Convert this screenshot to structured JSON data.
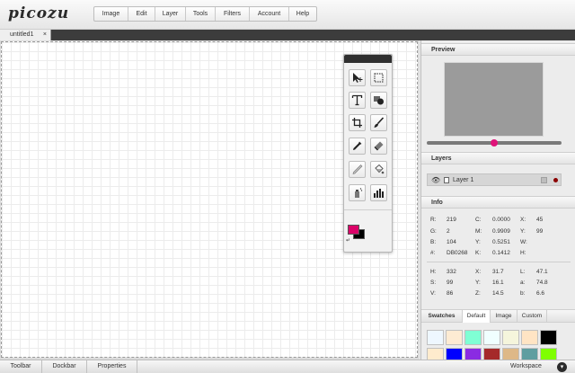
{
  "app": {
    "logo": "picozu"
  },
  "menu": {
    "items": [
      "Image",
      "Edit",
      "Layer",
      "Tools",
      "Filters",
      "Account",
      "Help"
    ]
  },
  "document": {
    "tab_title": "untitled1",
    "close_glyph": "×"
  },
  "toolbox": {
    "tools": [
      "move-tool",
      "marquee-select-tool",
      "text-tool",
      "shape-tool",
      "crop-tool",
      "brush-tool",
      "eyedropper-tool",
      "eraser-tool",
      "smudge-tool",
      "fill-tool",
      "spray-tool",
      "histogram-tool"
    ],
    "foreground_color": "#DB0268",
    "background_color": "#000000"
  },
  "panels": {
    "preview": {
      "title": "Preview",
      "zoom_level": 0.5
    },
    "layers": {
      "title": "Layers",
      "items": [
        {
          "name": "Layer 1"
        }
      ]
    },
    "info": {
      "title": "Info",
      "rgb": {
        "r_label": "R:",
        "r": "219",
        "g_label": "G:",
        "g": "2",
        "b_label": "B:",
        "b": "104",
        "hex_label": "#:",
        "hex": "DB0268"
      },
      "cmyk": {
        "c_label": "C:",
        "c": "0.0000",
        "m_label": "M:",
        "m": "0.9909",
        "y_label": "Y:",
        "y": "0.5251",
        "k_label": "K:",
        "k": "0.1412"
      },
      "pos": {
        "x_label": "X:",
        "x": "45",
        "y_label": "Y:",
        "y": "99",
        "w_label": "W:",
        "h_label": "H:"
      },
      "hsv": {
        "h_label": "H:",
        "h": "332",
        "s_label": "S:",
        "s": "99",
        "v_label": "V:",
        "v": "86"
      },
      "xyz": {
        "x_label": "X:",
        "x": "31.7",
        "y_label": "Y:",
        "y": "16.1",
        "z_label": "Z:",
        "z": "14.5"
      },
      "lab": {
        "l_label": "L:",
        "l": "47.1",
        "a_label": "a:",
        "a": "74.8",
        "b_label": "b:",
        "b": "6.6"
      }
    },
    "swatches": {
      "tabs": [
        "Swatches",
        "Default",
        "Image",
        "Custom"
      ],
      "active_tab": "Default",
      "colors": [
        "#EEF7FF",
        "#FDEBD3",
        "#7FFFD4",
        "#F0FFFF",
        "#F5F5DC",
        "#FFE4C4",
        "#000000",
        "#FFEBCD",
        "#0000FF",
        "#8A2BE2",
        "#A52A2A",
        "#DEB887",
        "#5F9EA0",
        "#7FFF00"
      ]
    }
  },
  "bottombar": {
    "items": [
      "Toolbar",
      "Dockbar",
      "Properties"
    ],
    "workspace_label": "Workspace"
  }
}
